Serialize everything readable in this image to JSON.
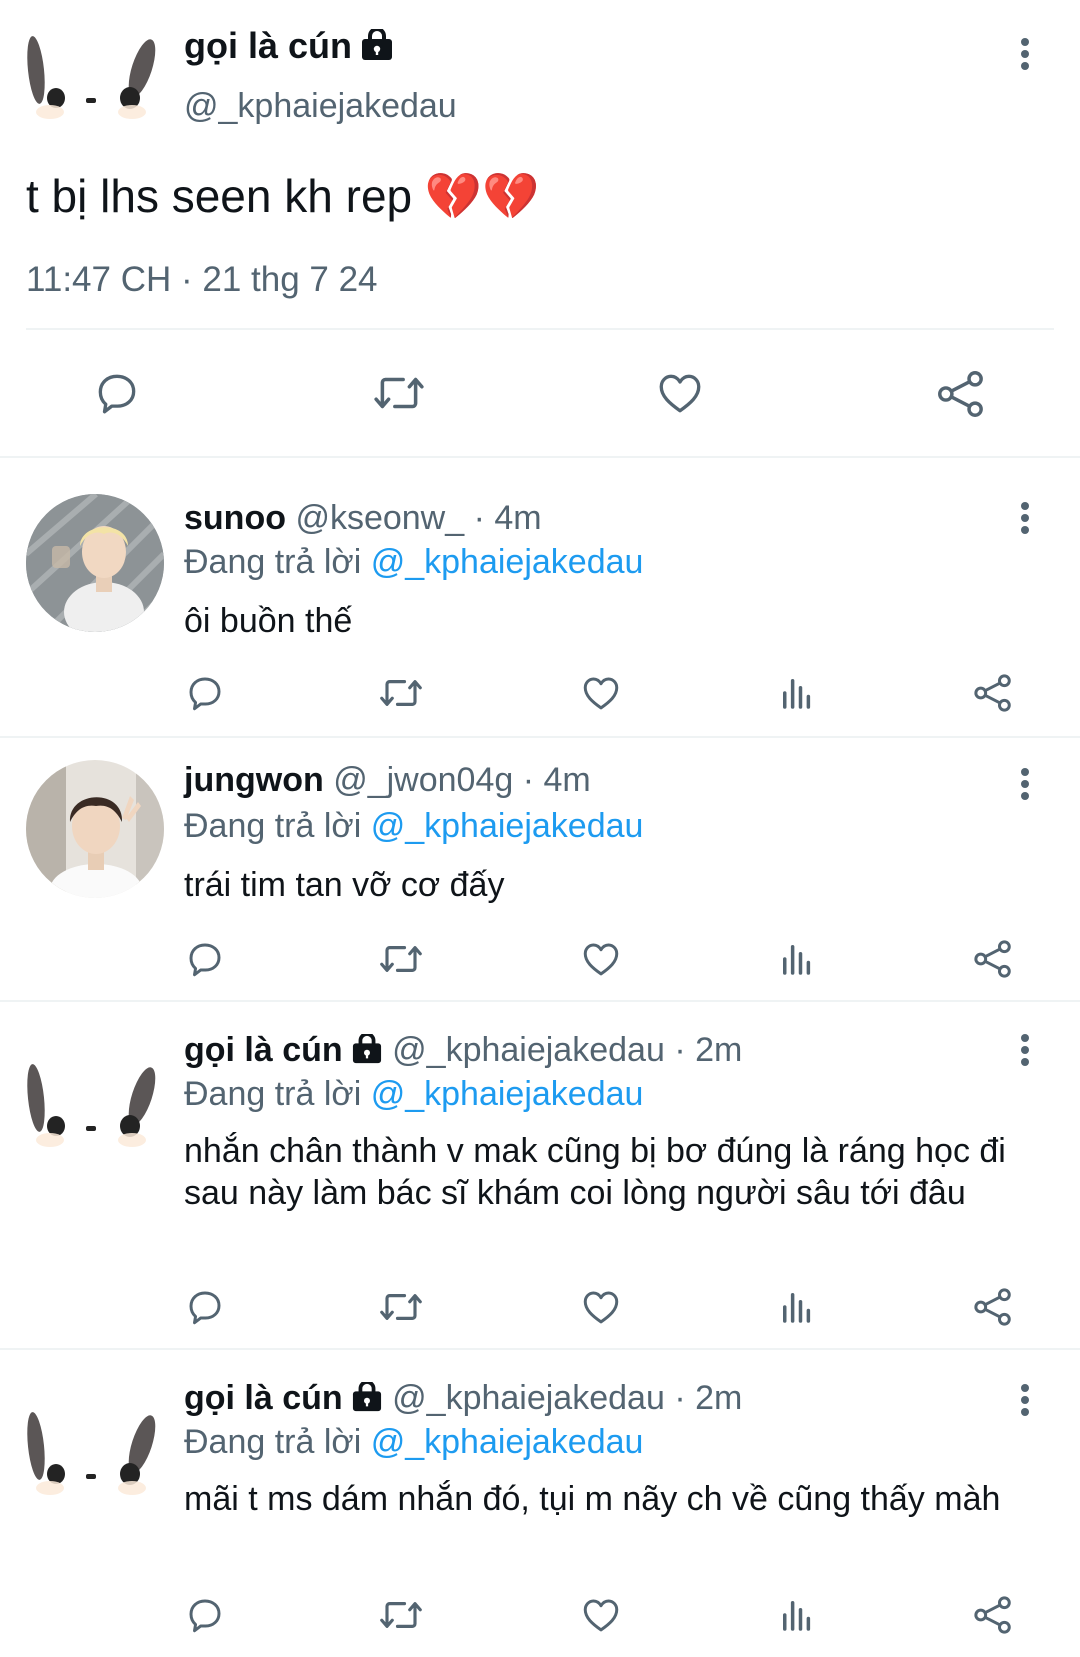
{
  "main_tweet": {
    "name": "gọi là cún",
    "handle": "@_kphaiejakedau",
    "text": "t bị lhs seen kh rep 💔💔",
    "timestamp": "11:47 CH · 21 thg 7 24"
  },
  "replies": [
    {
      "name": "sunoo",
      "handle": "@kseonw_",
      "time": "· 4m",
      "replying_prefix": "Đang trả lời",
      "replying_to": "@_kphaiejakedau",
      "text": "ôi buồn thế",
      "locked": false
    },
    {
      "name": "jungwon",
      "handle": "@_jwon04g",
      "time": "· 4m",
      "replying_prefix": "Đang trả lời",
      "replying_to": "@_kphaiejakedau",
      "text": "trái tim tan vỡ cơ đấy",
      "locked": false
    },
    {
      "name": "gọi là cún",
      "handle": "@_kphaiejakedau",
      "time": "· 2m",
      "replying_prefix": "Đang trả lời",
      "replying_to": "@_kphaiejakedau",
      "text": "nhắn chân thành v mak cũng bị bơ đúng là ráng học đi sau này làm bác sĩ khám coi lòng người sâu tới đâu",
      "locked": true
    },
    {
      "name": "gọi là cún",
      "handle": "@_kphaiejakedau",
      "time": "· 2m",
      "replying_prefix": "Đang trả lời",
      "replying_to": "@_kphaiejakedau",
      "text": "mãi t ms dám nhắn đó, tụi m nãy ch về cũng thấy màh",
      "locked": true
    }
  ],
  "colors": {
    "text": "#0f1419",
    "muted": "#536471",
    "link": "#1d9bf0",
    "divider": "#eff3f4"
  }
}
